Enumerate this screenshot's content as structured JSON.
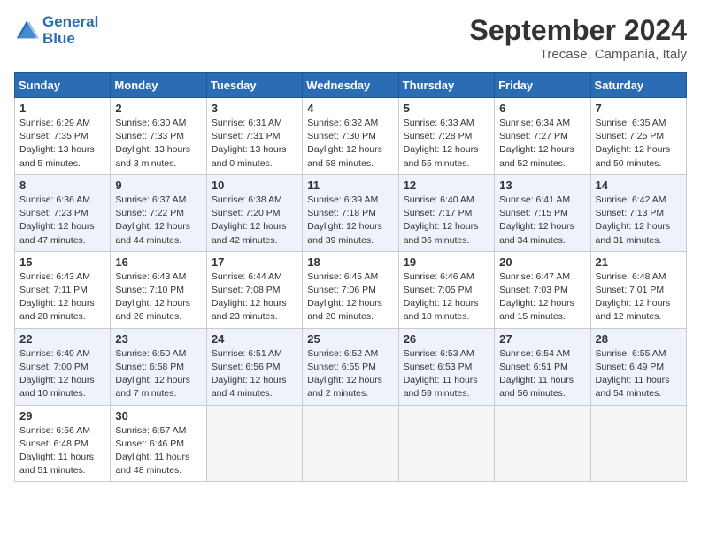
{
  "header": {
    "logo_line1": "General",
    "logo_line2": "Blue",
    "month_title": "September 2024",
    "location": "Trecase, Campania, Italy"
  },
  "days_of_week": [
    "Sunday",
    "Monday",
    "Tuesday",
    "Wednesday",
    "Thursday",
    "Friday",
    "Saturday"
  ],
  "weeks": [
    [
      {
        "num": "1",
        "sunrise": "6:29 AM",
        "sunset": "7:35 PM",
        "daylight": "13 hours and 5 minutes."
      },
      {
        "num": "2",
        "sunrise": "6:30 AM",
        "sunset": "7:33 PM",
        "daylight": "13 hours and 3 minutes."
      },
      {
        "num": "3",
        "sunrise": "6:31 AM",
        "sunset": "7:31 PM",
        "daylight": "13 hours and 0 minutes."
      },
      {
        "num": "4",
        "sunrise": "6:32 AM",
        "sunset": "7:30 PM",
        "daylight": "12 hours and 58 minutes."
      },
      {
        "num": "5",
        "sunrise": "6:33 AM",
        "sunset": "7:28 PM",
        "daylight": "12 hours and 55 minutes."
      },
      {
        "num": "6",
        "sunrise": "6:34 AM",
        "sunset": "7:27 PM",
        "daylight": "12 hours and 52 minutes."
      },
      {
        "num": "7",
        "sunrise": "6:35 AM",
        "sunset": "7:25 PM",
        "daylight": "12 hours and 50 minutes."
      }
    ],
    [
      {
        "num": "8",
        "sunrise": "6:36 AM",
        "sunset": "7:23 PM",
        "daylight": "12 hours and 47 minutes."
      },
      {
        "num": "9",
        "sunrise": "6:37 AM",
        "sunset": "7:22 PM",
        "daylight": "12 hours and 44 minutes."
      },
      {
        "num": "10",
        "sunrise": "6:38 AM",
        "sunset": "7:20 PM",
        "daylight": "12 hours and 42 minutes."
      },
      {
        "num": "11",
        "sunrise": "6:39 AM",
        "sunset": "7:18 PM",
        "daylight": "12 hours and 39 minutes."
      },
      {
        "num": "12",
        "sunrise": "6:40 AM",
        "sunset": "7:17 PM",
        "daylight": "12 hours and 36 minutes."
      },
      {
        "num": "13",
        "sunrise": "6:41 AM",
        "sunset": "7:15 PM",
        "daylight": "12 hours and 34 minutes."
      },
      {
        "num": "14",
        "sunrise": "6:42 AM",
        "sunset": "7:13 PM",
        "daylight": "12 hours and 31 minutes."
      }
    ],
    [
      {
        "num": "15",
        "sunrise": "6:43 AM",
        "sunset": "7:11 PM",
        "daylight": "12 hours and 28 minutes."
      },
      {
        "num": "16",
        "sunrise": "6:43 AM",
        "sunset": "7:10 PM",
        "daylight": "12 hours and 26 minutes."
      },
      {
        "num": "17",
        "sunrise": "6:44 AM",
        "sunset": "7:08 PM",
        "daylight": "12 hours and 23 minutes."
      },
      {
        "num": "18",
        "sunrise": "6:45 AM",
        "sunset": "7:06 PM",
        "daylight": "12 hours and 20 minutes."
      },
      {
        "num": "19",
        "sunrise": "6:46 AM",
        "sunset": "7:05 PM",
        "daylight": "12 hours and 18 minutes."
      },
      {
        "num": "20",
        "sunrise": "6:47 AM",
        "sunset": "7:03 PM",
        "daylight": "12 hours and 15 minutes."
      },
      {
        "num": "21",
        "sunrise": "6:48 AM",
        "sunset": "7:01 PM",
        "daylight": "12 hours and 12 minutes."
      }
    ],
    [
      {
        "num": "22",
        "sunrise": "6:49 AM",
        "sunset": "7:00 PM",
        "daylight": "12 hours and 10 minutes."
      },
      {
        "num": "23",
        "sunrise": "6:50 AM",
        "sunset": "6:58 PM",
        "daylight": "12 hours and 7 minutes."
      },
      {
        "num": "24",
        "sunrise": "6:51 AM",
        "sunset": "6:56 PM",
        "daylight": "12 hours and 4 minutes."
      },
      {
        "num": "25",
        "sunrise": "6:52 AM",
        "sunset": "6:55 PM",
        "daylight": "12 hours and 2 minutes."
      },
      {
        "num": "26",
        "sunrise": "6:53 AM",
        "sunset": "6:53 PM",
        "daylight": "11 hours and 59 minutes."
      },
      {
        "num": "27",
        "sunrise": "6:54 AM",
        "sunset": "6:51 PM",
        "daylight": "11 hours and 56 minutes."
      },
      {
        "num": "28",
        "sunrise": "6:55 AM",
        "sunset": "6:49 PM",
        "daylight": "11 hours and 54 minutes."
      }
    ],
    [
      {
        "num": "29",
        "sunrise": "6:56 AM",
        "sunset": "6:48 PM",
        "daylight": "11 hours and 51 minutes."
      },
      {
        "num": "30",
        "sunrise": "6:57 AM",
        "sunset": "6:46 PM",
        "daylight": "11 hours and 48 minutes."
      },
      null,
      null,
      null,
      null,
      null
    ]
  ]
}
